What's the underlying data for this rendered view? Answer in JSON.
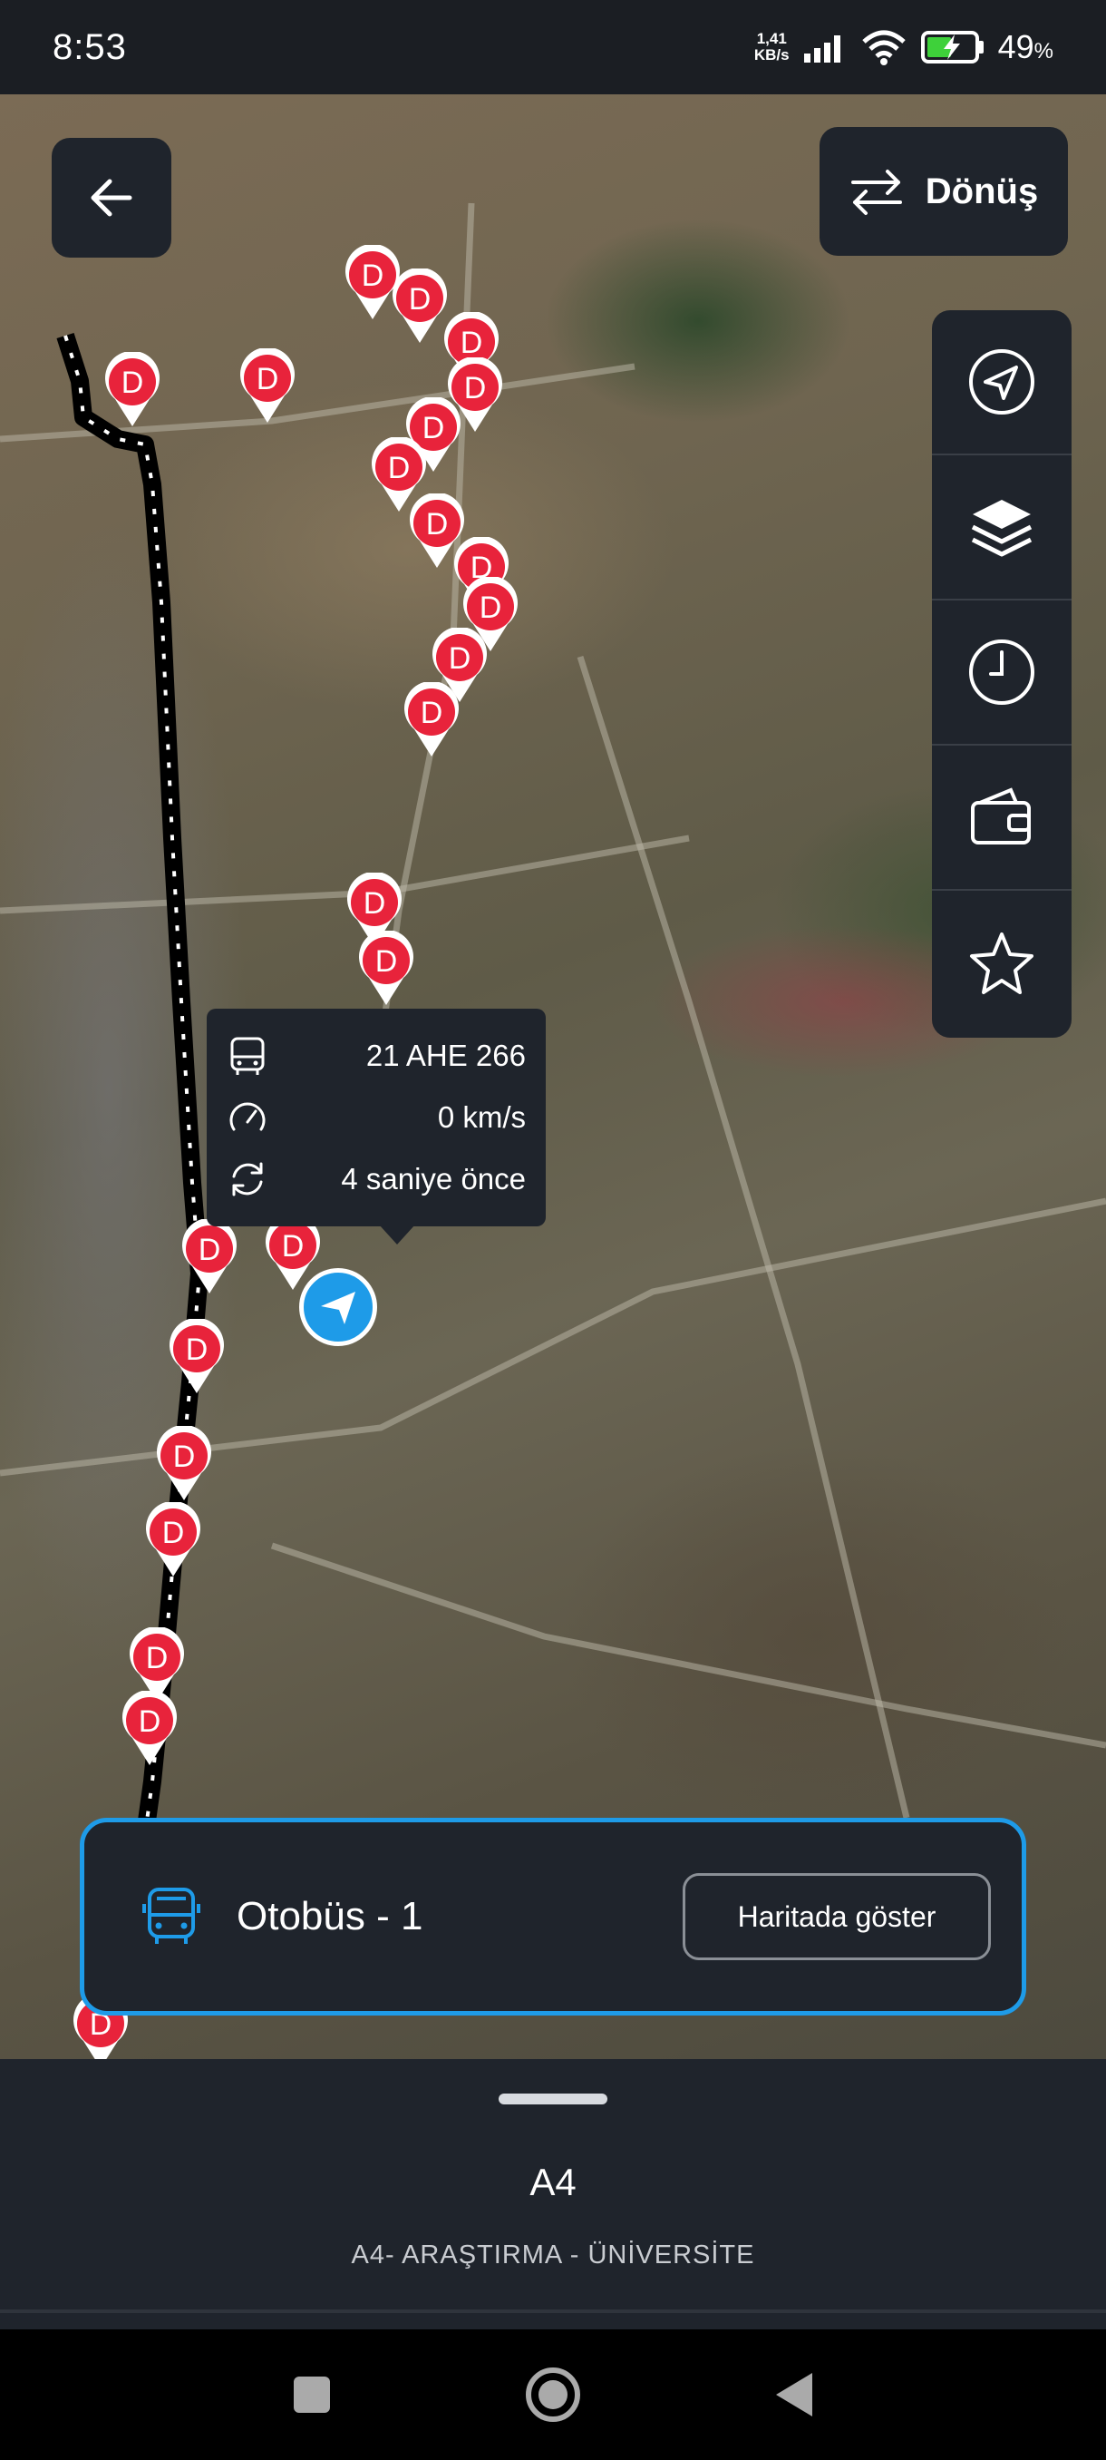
{
  "status_bar": {
    "time": "8:53",
    "net_speed_value": "1,41",
    "net_speed_unit": "KB/s",
    "battery_percent": "49",
    "battery_unit": "%"
  },
  "map": {
    "stop_marker_letter": "D",
    "stop_marker_color": "#e8233b",
    "route_color": "#000000",
    "vehicle_color": "#1e9be8"
  },
  "header": {
    "back_icon": "arrow-left-icon",
    "return_label": "Dönüş",
    "return_icon": "swap-arrows-icon"
  },
  "side_tools": [
    {
      "name": "location",
      "icon": "navigation-arrow-icon"
    },
    {
      "name": "layers",
      "icon": "layers-icon"
    },
    {
      "name": "schedule",
      "icon": "clock-icon"
    },
    {
      "name": "wallet",
      "icon": "wallet-icon"
    },
    {
      "name": "favorites",
      "icon": "star-icon"
    }
  ],
  "vehicle_info": {
    "plate": "21 AHE 266",
    "speed": "0 km/s",
    "updated": "4 saniye önce"
  },
  "bus_card": {
    "title": "Otobüs - 1",
    "show_on_map_label": "Haritada göster",
    "accent_color": "#1e9be8"
  },
  "route": {
    "code": "A4",
    "name": "A4- ARAŞTIRMA - ÜNİVERSİTE"
  }
}
